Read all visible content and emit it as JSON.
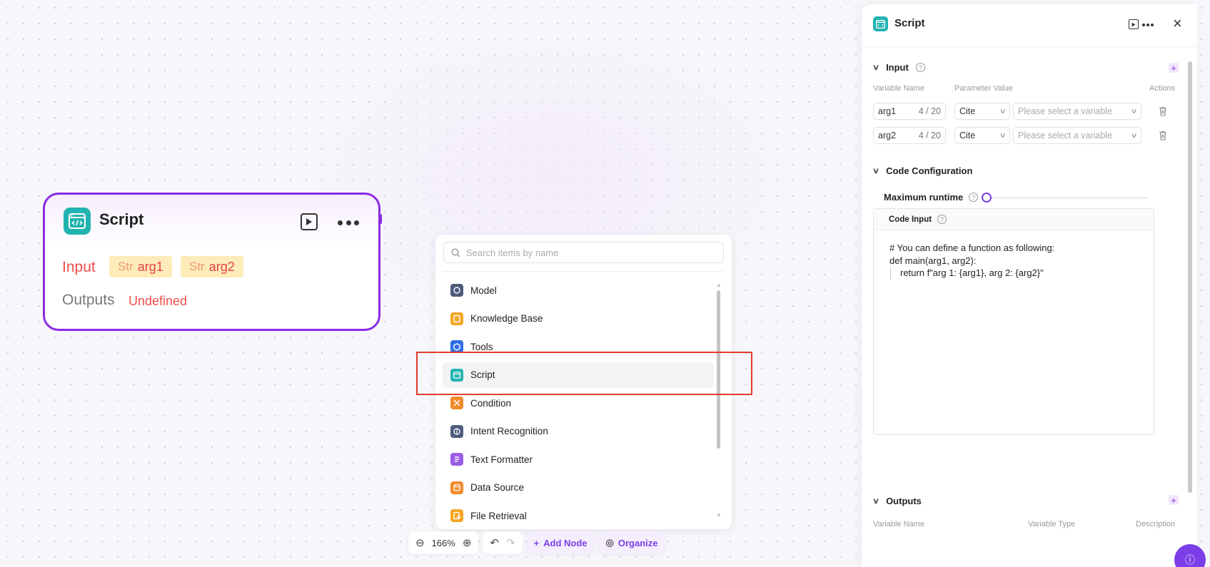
{
  "colors": {
    "accent": "#8a2be2",
    "accent_btn": "#7b3ee8",
    "danger": "#ee4d4d",
    "highlight": "#e23c2f",
    "script_teal": "#21b3b0"
  },
  "node": {
    "title": "Script",
    "input_label": "Input",
    "tags": [
      {
        "type": "Str",
        "name": "arg1"
      },
      {
        "type": "Str",
        "name": "arg2"
      }
    ],
    "outputs_label": "Outputs",
    "outputs_value": "Undefined"
  },
  "picker": {
    "search_placeholder": "Search items by name",
    "items": [
      {
        "label": "Model",
        "icon": "model-icon",
        "color": "#4d5b7c"
      },
      {
        "label": "Knowledge Base",
        "icon": "knowledge-base-icon",
        "color": "#f5a524"
      },
      {
        "label": "Tools",
        "icon": "tools-icon",
        "color": "#2f6fe0"
      },
      {
        "label": "Script",
        "icon": "script-icon",
        "color": "#21b3b0"
      },
      {
        "label": "Condition",
        "icon": "condition-icon",
        "color": "#f08a2a"
      },
      {
        "label": "Intent Recognition",
        "icon": "intent-recognition-icon",
        "color": "#4d5b7c"
      },
      {
        "label": "Text Formatter",
        "icon": "text-formatter-icon",
        "color": "#9b5de5"
      },
      {
        "label": "Data Source",
        "icon": "data-source-icon",
        "color": "#f08a2a"
      },
      {
        "label": "File Retrieval",
        "icon": "file-retrieval-icon",
        "color": "#f5a524"
      }
    ],
    "selected": "Script"
  },
  "toolbar": {
    "zoom": "166%",
    "add_node": "Add Node",
    "organize": "Organize"
  },
  "panel": {
    "title": "Script",
    "input": {
      "title": "Input",
      "col_name": "Variable Name",
      "col_value": "Parameter Value",
      "col_actions": "Actions",
      "rows": [
        {
          "name": "arg1",
          "count": "4 / 20",
          "mode": "Cite",
          "placeholder": "Please select a variable"
        },
        {
          "name": "arg2",
          "count": "4 / 20",
          "mode": "Cite",
          "placeholder": "Please select a variable"
        }
      ]
    },
    "code_config": {
      "title": "Code Configuration",
      "runtime_label": "Maximum runtime",
      "runtime_value": 0,
      "code_input_label": "Code Input",
      "code_lines": [
        "# You can define a function as following:",
        "def main(arg1, arg2):",
        "return f\"arg 1: {arg1}, arg 2: {arg2}\""
      ]
    },
    "outputs": {
      "title": "Outputs",
      "col_name": "Variable Name",
      "col_type": "Variable Type",
      "col_desc": "Description"
    }
  }
}
